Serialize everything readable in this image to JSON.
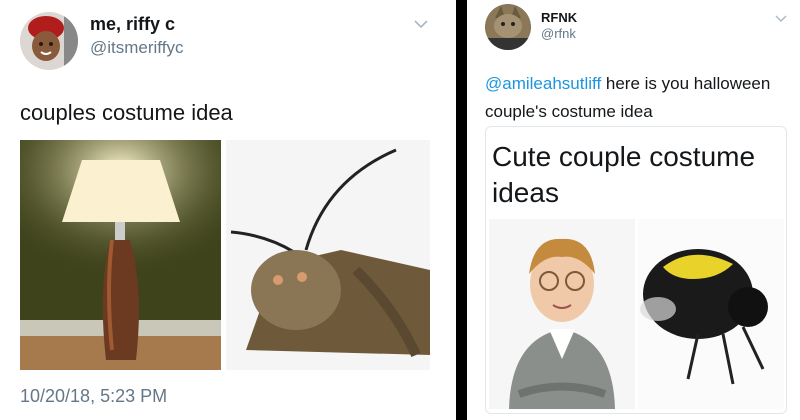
{
  "left_tweet": {
    "display_name": "me, riffy c",
    "handle": "@itsmeriffyc",
    "text": "couples costume idea",
    "timestamp": "10/20/18, 5:23 PM",
    "avatar_icon": "user-avatar-icon",
    "images": [
      "lamp-image",
      "moth-image"
    ]
  },
  "right_tweet": {
    "display_name": "RFNK",
    "handle": "@rfnk",
    "mention": "@amileahsutliff",
    "text": " here is you halloween couple's costume idea",
    "card_title": "Cute couple costume ideas",
    "avatar_icon": "cat-avatar-icon",
    "images": [
      "boy-glasses-image",
      "bumblebee-image"
    ]
  },
  "colors": {
    "text": "#14171a",
    "muted": "#657786",
    "link": "#1b95e0",
    "divider": "#000000"
  }
}
